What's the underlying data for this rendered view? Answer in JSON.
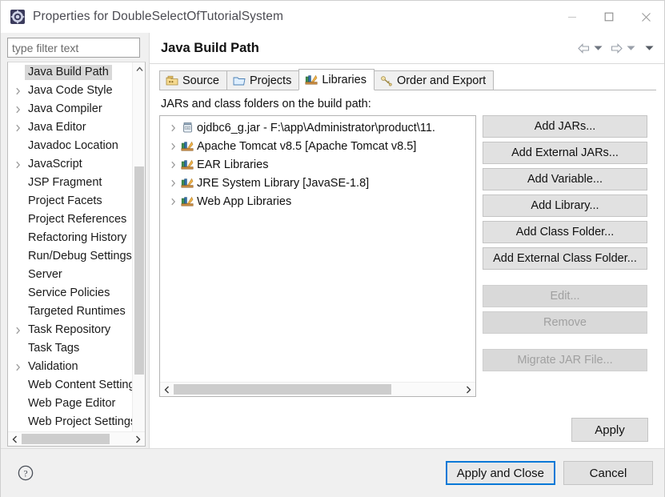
{
  "window": {
    "title": "Properties for DoubleSelectOfTutorialSystem",
    "app_icon": "eclipse-properties-icon",
    "controls": {
      "minimize": "minimize-icon",
      "maximize": "maximize-icon",
      "close": "close-icon"
    }
  },
  "sidebar": {
    "filter_placeholder": "type filter text",
    "filter_value": "",
    "items": [
      {
        "label": "Java Build Path",
        "expandable": false,
        "selected": true
      },
      {
        "label": "Java Code Style",
        "expandable": true,
        "selected": false
      },
      {
        "label": "Java Compiler",
        "expandable": true,
        "selected": false
      },
      {
        "label": "Java Editor",
        "expandable": true,
        "selected": false
      },
      {
        "label": "Javadoc Location",
        "expandable": false,
        "selected": false
      },
      {
        "label": "JavaScript",
        "expandable": true,
        "selected": false
      },
      {
        "label": "JSP Fragment",
        "expandable": false,
        "selected": false
      },
      {
        "label": "Project Facets",
        "expandable": false,
        "selected": false
      },
      {
        "label": "Project References",
        "expandable": false,
        "selected": false
      },
      {
        "label": "Refactoring History",
        "expandable": false,
        "selected": false
      },
      {
        "label": "Run/Debug Settings",
        "expandable": false,
        "selected": false
      },
      {
        "label": "Server",
        "expandable": false,
        "selected": false
      },
      {
        "label": "Service Policies",
        "expandable": false,
        "selected": false
      },
      {
        "label": "Targeted Runtimes",
        "expandable": false,
        "selected": false
      },
      {
        "label": "Task Repository",
        "expandable": true,
        "selected": false
      },
      {
        "label": "Task Tags",
        "expandable": false,
        "selected": false
      },
      {
        "label": "Validation",
        "expandable": true,
        "selected": false
      },
      {
        "label": "Web Content Settings",
        "expandable": false,
        "selected": false
      },
      {
        "label": "Web Page Editor",
        "expandable": false,
        "selected": false
      },
      {
        "label": "Web Project Settings",
        "expandable": false,
        "selected": false
      }
    ]
  },
  "page": {
    "title": "Java Build Path",
    "nav": {
      "back": "back-arrow-icon",
      "back_menu": "chevron-down-icon",
      "forward": "forward-arrow-icon",
      "forward_menu": "chevron-down-icon",
      "view_menu": "chevron-down-icon"
    }
  },
  "tabs": [
    {
      "label": "Source",
      "icon": "source-folder-icon",
      "active": false
    },
    {
      "label": "Projects",
      "icon": "projects-icon",
      "active": false
    },
    {
      "label": "Libraries",
      "icon": "libraries-icon",
      "active": true
    },
    {
      "label": "Order and Export",
      "icon": "order-export-icon",
      "active": false
    }
  ],
  "libraries_panel": {
    "section_label": "JARs and class folders on the build path:",
    "entries": [
      {
        "label": "ojdbc6_g.jar - F:\\app\\Administrator\\product\\11.",
        "icon": "jar-icon",
        "expandable": true
      },
      {
        "label": "Apache Tomcat v8.5 [Apache Tomcat v8.5]",
        "icon": "library-icon",
        "expandable": true
      },
      {
        "label": "EAR Libraries",
        "icon": "library-icon",
        "expandable": true
      },
      {
        "label": "JRE System Library [JavaSE-1.8]",
        "icon": "library-icon",
        "expandable": true
      },
      {
        "label": "Web App Libraries",
        "icon": "library-icon",
        "expandable": true
      }
    ],
    "scroll": {
      "left_arrow": "chevron-left-icon",
      "right_arrow": "chevron-right-icon"
    },
    "buttons": [
      {
        "label": "Add JARs...",
        "disabled": false,
        "gap_before": false
      },
      {
        "label": "Add External JARs...",
        "disabled": false,
        "gap_before": false
      },
      {
        "label": "Add Variable...",
        "disabled": false,
        "gap_before": false
      },
      {
        "label": "Add Library...",
        "disabled": false,
        "gap_before": false
      },
      {
        "label": "Add Class Folder...",
        "disabled": false,
        "gap_before": false
      },
      {
        "label": "Add External Class Folder...",
        "disabled": false,
        "gap_before": false
      },
      {
        "label": "Edit...",
        "disabled": true,
        "gap_before": true
      },
      {
        "label": "Remove",
        "disabled": true,
        "gap_before": false
      },
      {
        "label": "Migrate JAR File...",
        "disabled": true,
        "gap_before": true
      }
    ],
    "apply_label": "Apply"
  },
  "footer": {
    "help_icon": "help-question-icon",
    "apply_and_close_label": "Apply and Close",
    "cancel_label": "Cancel"
  },
  "colors": {
    "focus_border": "#0078d7",
    "dialog_bg": "#f0f0f0",
    "panel_bg": "#ffffff",
    "button_bg": "#e1e1e1",
    "selection_bg": "#d8d8d8"
  }
}
